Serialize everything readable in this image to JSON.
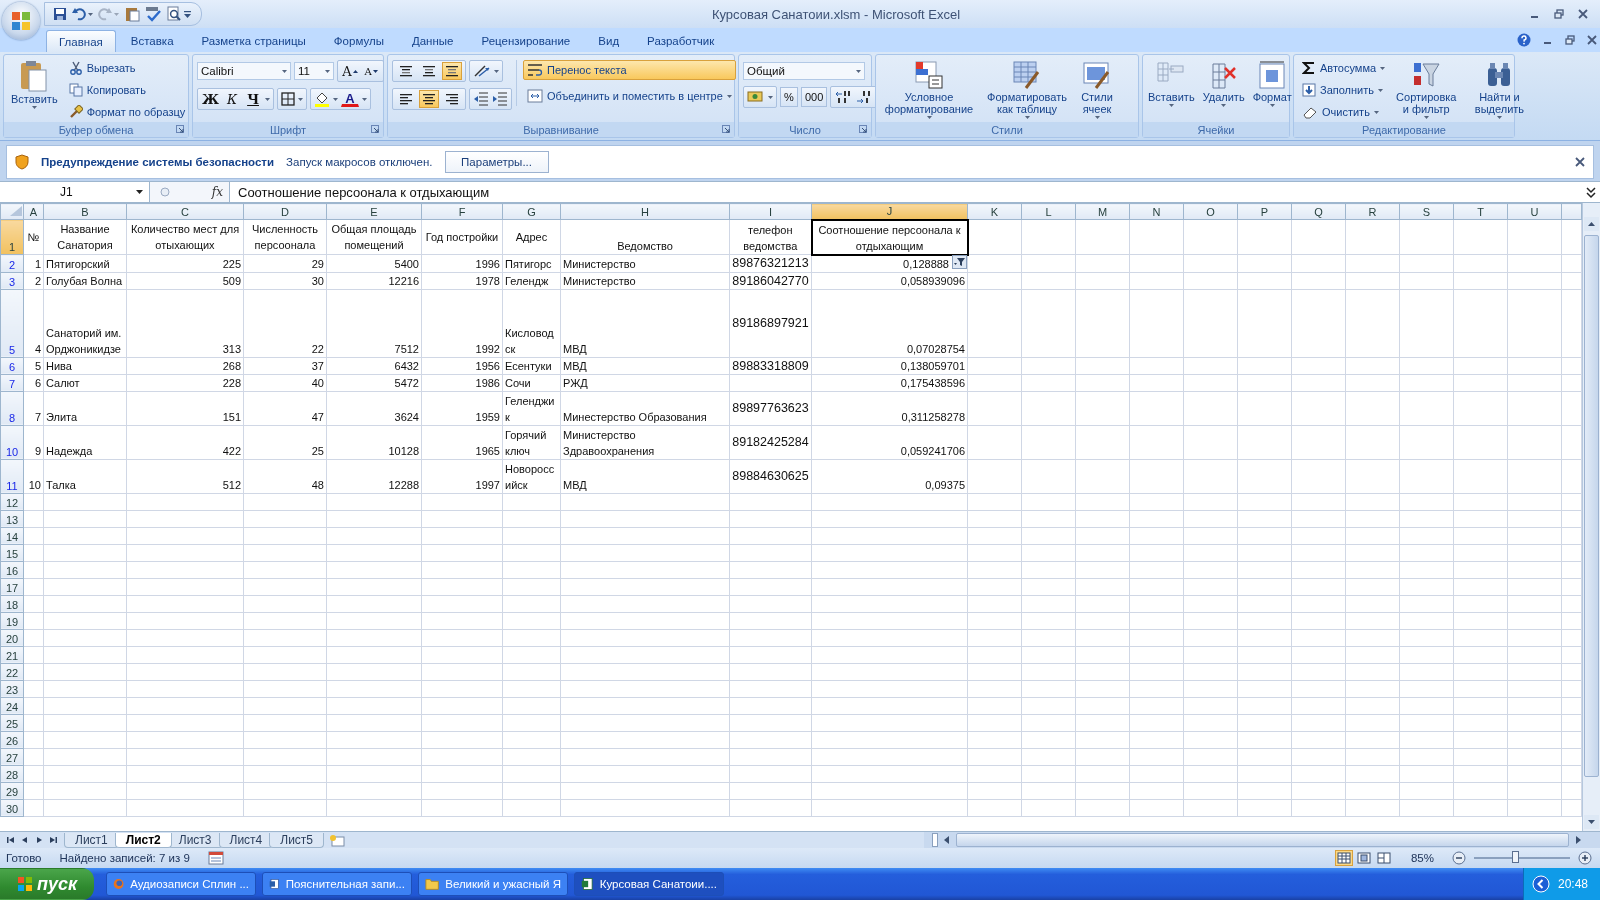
{
  "window": {
    "title": "Курсовая Санатоии.xlsm - Microsoft Excel"
  },
  "ribbon_tabs": [
    {
      "label": "Главная",
      "selected": true
    },
    {
      "label": "Вставка",
      "selected": false
    },
    {
      "label": "Разметка страницы",
      "selected": false
    },
    {
      "label": "Формулы",
      "selected": false
    },
    {
      "label": "Данные",
      "selected": false
    },
    {
      "label": "Рецензирование",
      "selected": false
    },
    {
      "label": "Вид",
      "selected": false
    },
    {
      "label": "Разработчик",
      "selected": false
    }
  ],
  "ribbon_groups": [
    {
      "kind": "clipboard",
      "title": "Буфер обмена",
      "paste": "Вставить",
      "items": [
        "Вырезать",
        "Копировать",
        "Формат по образцу"
      ]
    },
    {
      "kind": "font",
      "title": "Шрифт",
      "font": "Calibri",
      "size": "11",
      "grow": "A",
      "shrink": "A",
      "bold": "Ж",
      "italic": "К",
      "underline": "Ч",
      "font_color": "A"
    },
    {
      "kind": "alignment",
      "title": "Выравнивание",
      "valign": [
        {
          "selected": false
        },
        {
          "selected": false
        },
        {
          "selected": true
        }
      ],
      "halign": [
        {
          "selected": false
        },
        {
          "selected": true
        },
        {
          "selected": false
        }
      ],
      "wrap": {
        "label": "Перенос текста",
        "on": true
      },
      "merge": "Объединить и поместить в центре"
    },
    {
      "kind": "number",
      "title": "Число",
      "format": "Общий",
      "percent": "%",
      "thousands": "000"
    },
    {
      "kind": "styles",
      "title": "Стили",
      "items": [
        "Условное форматирование",
        "Форматировать как таблицу",
        "Стили ячеек"
      ]
    },
    {
      "kind": "cells",
      "title": "Ячейки",
      "items": [
        "Вставить",
        "Удалить",
        "Формат"
      ]
    },
    {
      "kind": "editing",
      "title": "Редактирование",
      "small": [
        "Автосумма",
        "Заполнить",
        "Очистить"
      ],
      "large": [
        "Сортировка и фильтр",
        "Найти и выделить"
      ]
    }
  ],
  "security_bar": {
    "title": "Предупреждение системы безопасности",
    "message": "Запуск макросов отключен.",
    "button": "Параметры..."
  },
  "formula_bar": {
    "name_box": "J1",
    "function_label": "fx",
    "content": "Соотношение персоонала к отдыхающим"
  },
  "sheet": {
    "columns": [
      {
        "label": "A",
        "selected": false,
        "filter": false
      },
      {
        "label": "B",
        "selected": false,
        "filter": false
      },
      {
        "label": "C",
        "selected": false,
        "filter": false
      },
      {
        "label": "D",
        "selected": false,
        "filter": false
      },
      {
        "label": "E",
        "selected": false,
        "filter": false
      },
      {
        "label": "F",
        "selected": false,
        "filter": false
      },
      {
        "label": "G",
        "selected": false,
        "filter": false
      },
      {
        "label": "H",
        "selected": false,
        "filter": false
      },
      {
        "label": "I",
        "selected": false,
        "filter": false
      },
      {
        "label": "J",
        "selected": true,
        "filter": true
      },
      {
        "label": "K",
        "selected": false,
        "filter": false
      },
      {
        "label": "L",
        "selected": false,
        "filter": false
      },
      {
        "label": "M",
        "selected": false,
        "filter": false
      },
      {
        "label": "N",
        "selected": false,
        "filter": false
      },
      {
        "label": "O",
        "selected": false,
        "filter": false
      },
      {
        "label": "P",
        "selected": false,
        "filter": false
      },
      {
        "label": "Q",
        "selected": false,
        "filter": false
      },
      {
        "label": "R",
        "selected": false,
        "filter": false
      },
      {
        "label": "S",
        "selected": false,
        "filter": false
      },
      {
        "label": "T",
        "selected": false,
        "filter": false
      },
      {
        "label": "U",
        "selected": false,
        "filter": false
      }
    ],
    "rows": [
      {
        "number": "1",
        "selected": true,
        "filtered": false,
        "cells": [
          "№",
          "Название Санатория",
          "Количество мест для отыхающих",
          "Численность персоонала",
          "Общая площадь помещений",
          "Год постройки",
          "Адрес",
          "Ведомство",
          "телефон ведомства",
          "Соотношение персоонала к отдыхающим"
        ]
      },
      {
        "number": "2",
        "selected": false,
        "filtered": true,
        "cells": [
          "1",
          "Пятигорский",
          "225",
          "29",
          "5400",
          "1996",
          "Пятигорс",
          "Министерство",
          "89876321213",
          "0,128888"
        ]
      },
      {
        "number": "3",
        "selected": false,
        "filtered": true,
        "cells": [
          "2",
          "Голубая Волна",
          "509",
          "30",
          "12216",
          "1978",
          "Гелендж",
          "Министерство",
          "89186042770",
          "0,058939096"
        ]
      },
      {
        "number": "5",
        "selected": false,
        "filtered": true,
        "cells": [
          "4",
          "Санаторий им. Орджоникидзе",
          "313",
          "22",
          "7512",
          "1992",
          "Кисловодск",
          "МВД",
          "89186897921",
          "0,07028754"
        ]
      },
      {
        "number": "6",
        "selected": false,
        "filtered": true,
        "cells": [
          "5",
          "Нива",
          "268",
          "37",
          "6432",
          "1956",
          "Есентуки",
          "МВД",
          "89883318809",
          "0,138059701"
        ]
      },
      {
        "number": "7",
        "selected": false,
        "filtered": true,
        "cells": [
          "6",
          "Салют",
          "228",
          "40",
          "5472",
          "1986",
          "Сочи",
          "РЖД",
          null,
          "0,175438596"
        ]
      },
      {
        "number": "8",
        "selected": false,
        "filtered": true,
        "cells": [
          "7",
          "Элита",
          "151",
          "47",
          "3624",
          "1959",
          "Геленджик",
          "Минестерство Образования",
          "89897763623",
          "0,311258278"
        ]
      },
      {
        "number": "10",
        "selected": false,
        "filtered": true,
        "cells": [
          "9",
          "Надежда",
          "422",
          "25",
          "10128",
          "1965",
          "Горячий ключ",
          "Министерство Здравоохранения",
          "89182425284",
          "0,059241706"
        ]
      },
      {
        "number": "11",
        "selected": false,
        "filtered": true,
        "cells": [
          "10",
          "Талка",
          "512",
          "48",
          "12288",
          "1997",
          "Новороссийск",
          "МВД",
          "89884630625",
          "0,09375"
        ]
      },
      {
        "number": "12",
        "selected": false,
        "filtered": false
      },
      {
        "number": "13",
        "selected": false,
        "filtered": false
      },
      {
        "number": "14",
        "selected": false,
        "filtered": false
      },
      {
        "number": "15",
        "selected": false,
        "filtered": false
      },
      {
        "number": "16",
        "selected": false,
        "filtered": false
      },
      {
        "number": "17",
        "selected": false,
        "filtered": false
      },
      {
        "number": "18",
        "selected": false,
        "filtered": false
      },
      {
        "number": "19",
        "selected": false,
        "filtered": false
      },
      {
        "number": "20",
        "selected": false,
        "filtered": false
      },
      {
        "number": "21",
        "selected": false,
        "filtered": false
      },
      {
        "number": "22",
        "selected": false,
        "filtered": false
      },
      {
        "number": "23",
        "selected": false,
        "filtered": false
      },
      {
        "number": "24",
        "selected": false,
        "filtered": false
      },
      {
        "number": "25",
        "selected": false,
        "filtered": false
      },
      {
        "number": "26",
        "selected": false,
        "filtered": false
      },
      {
        "number": "27",
        "selected": false,
        "filtered": false
      },
      {
        "number": "28",
        "selected": false,
        "filtered": false
      },
      {
        "number": "29",
        "selected": false,
        "filtered": false
      },
      {
        "number": "30",
        "selected": false,
        "filtered": false
      }
    ]
  },
  "sheet_tabs": [
    {
      "label": "Лист1",
      "selected": false
    },
    {
      "label": "Лист2",
      "selected": true
    },
    {
      "label": "Лист3",
      "selected": false
    },
    {
      "label": "Лист4",
      "selected": false
    },
    {
      "label": "Лист5",
      "selected": false
    }
  ],
  "status_bar": {
    "ready": "Готово",
    "records": "Найдено записей: 7 из 9",
    "views": [
      {
        "selected": true
      },
      {
        "selected": false
      },
      {
        "selected": false
      }
    ],
    "zoom": {
      "label": "85%",
      "level": 0.43
    }
  },
  "taskbar": {
    "start": "пуск",
    "items": [
      {
        "label": "Аудиозаписи Сплин ...",
        "selected": false
      },
      {
        "label": "Пояснительная запи...",
        "selected": false
      },
      {
        "label": "Великий и ужасный Я",
        "selected": false
      },
      {
        "label": "Курсовая Санатоии....",
        "selected": true
      }
    ],
    "clock": "20:48"
  }
}
